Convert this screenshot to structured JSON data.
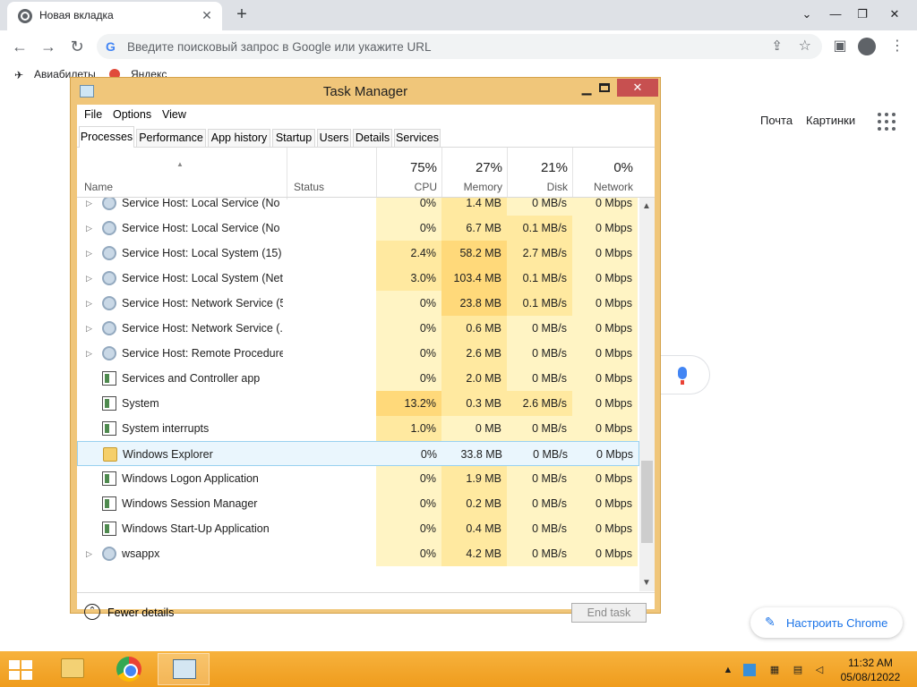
{
  "chrome": {
    "tab_title": "Новая вкладка",
    "omnibox_placeholder": "Введите поисковый запрос в Google или укажите URL",
    "bookmarks": [
      "Авиабилеты",
      "Яндекс"
    ],
    "google_links": [
      "Почта",
      "Картинки"
    ],
    "customize_label": "Настроить Chrome"
  },
  "taskmanager": {
    "title": "Task Manager",
    "menu": [
      "File",
      "Options",
      "View"
    ],
    "tabs": [
      "Processes",
      "Performance",
      "App history",
      "Startup",
      "Users",
      "Details",
      "Services"
    ],
    "active_tab": "Processes",
    "columns": {
      "name": "Name",
      "status": "Status",
      "cpu": "CPU",
      "memory": "Memory",
      "disk": "Disk",
      "network": "Network"
    },
    "totals": {
      "cpu": "75%",
      "memory": "27%",
      "disk": "21%",
      "network": "0%"
    },
    "rows": [
      {
        "name": "Service Host: Local Service (No I...",
        "cpu": "0%",
        "mem": "1.4 MB",
        "disk": "0 MB/s",
        "net": "0 Mbps",
        "icon": "gear-icon",
        "expandable": true
      },
      {
        "name": "Service Host: Local Service (No ...",
        "cpu": "0%",
        "mem": "6.7 MB",
        "disk": "0.1 MB/s",
        "net": "0 Mbps",
        "icon": "gear-icon",
        "expandable": true
      },
      {
        "name": "Service Host: Local System (15)",
        "cpu": "2.4%",
        "mem": "58.2 MB",
        "disk": "2.7 MB/s",
        "net": "0 Mbps",
        "icon": "gear-icon",
        "expandable": true
      },
      {
        "name": "Service Host: Local System (Net...",
        "cpu": "3.0%",
        "mem": "103.4 MB",
        "disk": "0.1 MB/s",
        "net": "0 Mbps",
        "icon": "gear-icon",
        "expandable": true
      },
      {
        "name": "Service Host: Network Service (5)",
        "cpu": "0%",
        "mem": "23.8 MB",
        "disk": "0.1 MB/s",
        "net": "0 Mbps",
        "icon": "gear-icon",
        "expandable": true
      },
      {
        "name": "Service Host: Network Service (...",
        "cpu": "0%",
        "mem": "0.6 MB",
        "disk": "0 MB/s",
        "net": "0 Mbps",
        "icon": "gear-icon",
        "expandable": true
      },
      {
        "name": "Service Host: Remote Procedure...",
        "cpu": "0%",
        "mem": "2.6 MB",
        "disk": "0 MB/s",
        "net": "0 Mbps",
        "icon": "gear-icon",
        "expandable": true
      },
      {
        "name": "Services and Controller app",
        "cpu": "0%",
        "mem": "2.0 MB",
        "disk": "0 MB/s",
        "net": "0 Mbps",
        "icon": "app-icon",
        "expandable": false
      },
      {
        "name": "System",
        "cpu": "13.2%",
        "mem": "0.3 MB",
        "disk": "2.6 MB/s",
        "net": "0 Mbps",
        "icon": "app-icon",
        "expandable": false
      },
      {
        "name": "System interrupts",
        "cpu": "1.0%",
        "mem": "0 MB",
        "disk": "0 MB/s",
        "net": "0 Mbps",
        "icon": "app-icon",
        "expandable": false
      },
      {
        "name": "Windows Explorer",
        "cpu": "0%",
        "mem": "33.8 MB",
        "disk": "0 MB/s",
        "net": "0 Mbps",
        "icon": "folder-icon",
        "expandable": false,
        "selected": true
      },
      {
        "name": "Windows Logon Application",
        "cpu": "0%",
        "mem": "1.9 MB",
        "disk": "0 MB/s",
        "net": "0 Mbps",
        "icon": "app-icon",
        "expandable": false
      },
      {
        "name": "Windows Session Manager",
        "cpu": "0%",
        "mem": "0.2 MB",
        "disk": "0 MB/s",
        "net": "0 Mbps",
        "icon": "app-icon",
        "expandable": false
      },
      {
        "name": "Windows Start-Up Application",
        "cpu": "0%",
        "mem": "0.4 MB",
        "disk": "0 MB/s",
        "net": "0 Mbps",
        "icon": "app-icon",
        "expandable": false
      },
      {
        "name": "wsappx",
        "cpu": "0%",
        "mem": "4.2 MB",
        "disk": "0 MB/s",
        "net": "0 Mbps",
        "icon": "gear-icon",
        "expandable": true
      }
    ],
    "fewer_details": "Fewer details",
    "end_task": "End task"
  },
  "taskbar": {
    "time": "11:32 AM",
    "date": "05/08/12022"
  },
  "colors": {
    "window_frame": "#f0c67a",
    "taskbar": "#f5a623",
    "heat_low": "#fff4c4",
    "heat_mid": "#ffe9a0",
    "heat_high": "#ffd97a",
    "selection": "#eaf6fd"
  }
}
